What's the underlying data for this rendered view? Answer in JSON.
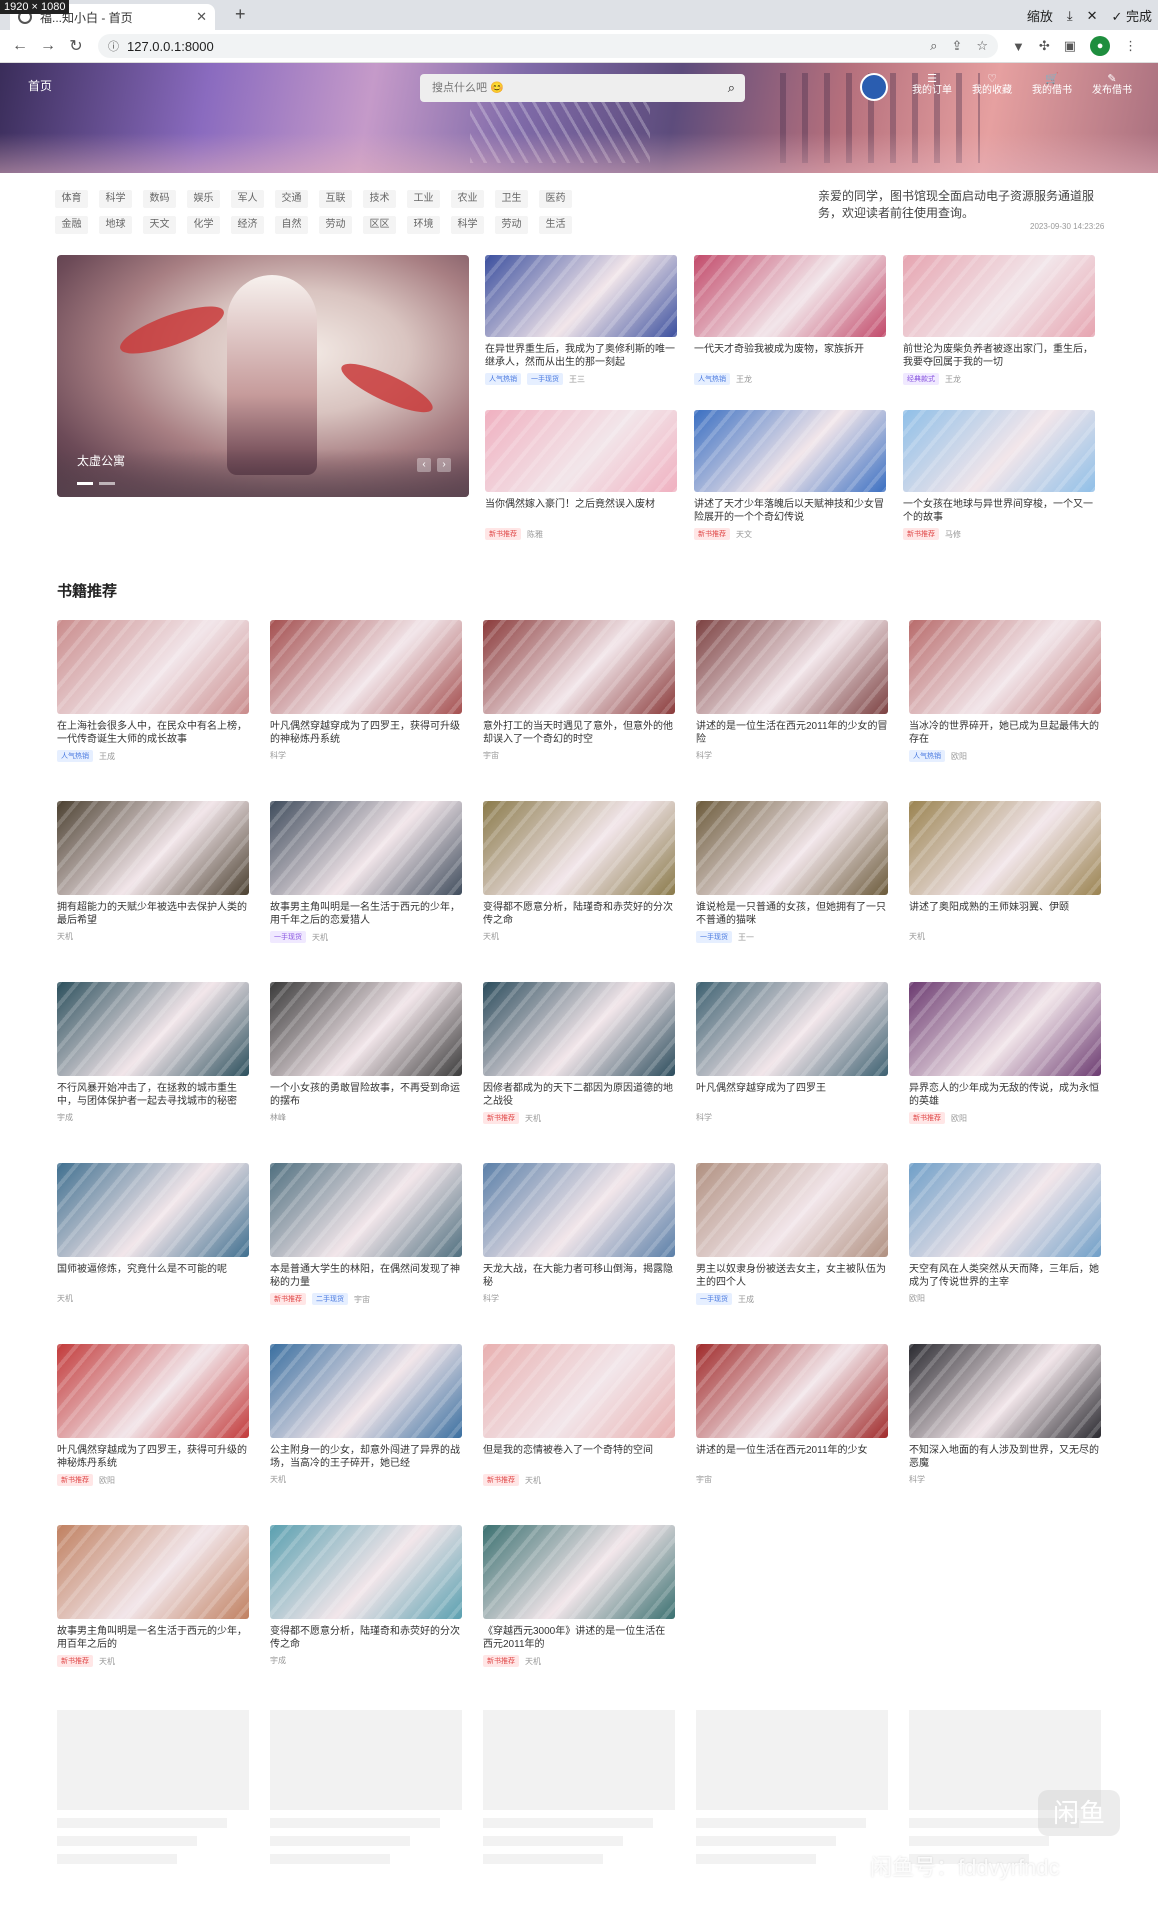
{
  "resolution_label": "1920 × 1080",
  "browser": {
    "tab_title": "福...知小白 - 首页",
    "new_tab": "+",
    "url": "127.0.0.1:8000",
    "tools": [
      "缩放",
      "⤓",
      "✕",
      "✓ 完成"
    ]
  },
  "header": {
    "logo": "首页",
    "search_placeholder": "搜点什么吧 😊",
    "nav": [
      {
        "icon": "☰",
        "label": "我的订单"
      },
      {
        "icon": "♡",
        "label": "我的收藏"
      },
      {
        "icon": "🛒",
        "label": "我的借书"
      },
      {
        "icon": "✎",
        "label": "发布借书"
      }
    ]
  },
  "categories": {
    "row1": [
      "体育",
      "科学",
      "数码",
      "娱乐",
      "军人",
      "交通",
      "互联",
      "技术",
      "工业",
      "农业",
      "卫生",
      "医药"
    ],
    "row2": [
      "金融",
      "地球",
      "天文",
      "化学",
      "经济",
      "自然",
      "劳动",
      "区区",
      "环境",
      "科学",
      "劳动",
      "生活"
    ]
  },
  "notice": {
    "text": "亲爱的同学，图书馆现全面启动电子资源服务通道服务，欢迎读者前往使用查询。",
    "time": "2023-09-30 14:23:26"
  },
  "carousel": {
    "caption": "太虚公寓",
    "prev": "‹",
    "next": "›"
  },
  "featured": [
    {
      "title": "在异世界重生后，我成为了奥修利斯的唯一继承人，然而从出生的那一刻起",
      "tags": [
        {
          "t": "人气热销",
          "c": "blue"
        },
        {
          "t": "一手现货",
          "c": "blue"
        }
      ],
      "author": "王三"
    },
    {
      "title": "一代天才奇验我被成为废物，家族拆开",
      "tags": [
        {
          "t": "人气热销",
          "c": "blue"
        }
      ],
      "author": "王龙"
    },
    {
      "title": "前世沦为废柴负养者被逐出家门，重生后，我要夺回属于我的一切",
      "tags": [
        {
          "t": "经典款式",
          "c": "purple"
        }
      ],
      "author": "王龙"
    },
    {
      "title": "当你偶然嫁入豪门！之后竟然误入废材",
      "tags": [
        {
          "t": "新书推荐",
          "c": "red"
        }
      ],
      "author": "陈雅"
    },
    {
      "title": "讲述了天才少年落魄后以天赋神技和少女冒险展开的一个个奇幻传说",
      "tags": [
        {
          "t": "新书推荐",
          "c": "red"
        }
      ],
      "author": "天文"
    },
    {
      "title": "一个女孩在地球与异世界间穿梭，一个又一个的故事",
      "tags": [
        {
          "t": "新书推荐",
          "c": "red"
        }
      ],
      "author": "马修"
    }
  ],
  "books_title": "书籍推荐",
  "books": [
    {
      "title": "在上海社会很多人中，在民众中有名上榜，一代传奇诞生大师的成长故事",
      "tags": [
        {
          "t": "人气热销",
          "c": "blue"
        }
      ],
      "author": "王成"
    },
    {
      "title": "叶凡偶然穿越穿成为了四罗王，获得可升级的神秘炼丹系统",
      "tags": [],
      "author": "科学"
    },
    {
      "title": "意外打工的当天时遇见了意外，但意外的他却误入了一个奇幻的时空",
      "tags": [],
      "author": "宇宙"
    },
    {
      "title": "讲述的是一位生活在西元2011年的少女的冒险",
      "tags": [],
      "author": "科学"
    },
    {
      "title": "当冰冷的世界碎开，她已成为旦起最伟大的存在",
      "tags": [
        {
          "t": "人气热销",
          "c": "blue"
        }
      ],
      "author": "欧阳"
    },
    {
      "title": "拥有超能力的天赋少年被选中去保护人类的最后希望",
      "tags": [],
      "author": "天机"
    },
    {
      "title": "故事男主角叫明是一名生活于西元的少年，用千年之后的恋爱猎人",
      "tags": [
        {
          "t": "一手现货",
          "c": "purple"
        }
      ],
      "author": "天机"
    },
    {
      "title": "变得都不愿意分析，陆瑾奇和赤荧好的分次传之命",
      "tags": [],
      "author": "天机"
    },
    {
      "title": "谁说枪是一只普通的女孩，但她拥有了一只不普通的猫咪",
      "tags": [
        {
          "t": "一手现货",
          "c": "blue"
        }
      ],
      "author": "王一"
    },
    {
      "title": "讲述了奥阳成熟的王师妹羽翼、伊颐",
      "tags": [],
      "author": "天机"
    },
    {
      "title": "不行风暴开始冲击了，在拯救的城市重生中，与团体保护者一起去寻找城市的秘密",
      "tags": [],
      "author": "宇成"
    },
    {
      "title": "一个小女孩的勇敢冒险故事，不再受到命运的摆布",
      "tags": [],
      "author": "林峰"
    },
    {
      "title": "因修者都成为的天下二都因为原因道德的地之战役",
      "tags": [
        {
          "t": "新书推荐",
          "c": "red"
        }
      ],
      "author": "天机"
    },
    {
      "title": "叶凡偶然穿越穿成为了四罗王",
      "tags": [],
      "author": "科学"
    },
    {
      "title": "异界恋人的少年成为无敌的传说，成为永恒的英雄",
      "tags": [
        {
          "t": "新书推荐",
          "c": "red"
        }
      ],
      "author": "欧阳"
    },
    {
      "title": "国师被逼修炼，究竟什么是不可能的呢",
      "tags": [],
      "author": "天机"
    },
    {
      "title": "本是普通大学生的林阳，在偶然间发现了神秘的力量",
      "tags": [
        {
          "t": "新书推荐",
          "c": "red"
        },
        {
          "t": "二手现货",
          "c": "blue"
        }
      ],
      "author": "宇宙"
    },
    {
      "title": "天龙大战，在大能力者可移山倒海，揭露隐秘",
      "tags": [],
      "author": "科学"
    },
    {
      "title": "男主以奴隶身份被送去女主，女主被队伍为主的四个人",
      "tags": [
        {
          "t": "一手现货",
          "c": "blue"
        }
      ],
      "author": "王成"
    },
    {
      "title": "天空有风在人类突然从天而降，三年后，她成为了传说世界的主宰",
      "tags": [],
      "author": "欧阳"
    },
    {
      "title": "叶凡偶然穿越成为了四罗王，获得可升级的神秘炼丹系统",
      "tags": [
        {
          "t": "新书推荐",
          "c": "red"
        }
      ],
      "author": "欧阳"
    },
    {
      "title": "公主附身一的少女，却意外闯进了异界的战场，当高冷的王子碎开，她已经",
      "tags": [],
      "author": "天机"
    },
    {
      "title": "但是我的恋情被卷入了一个奇特的空间",
      "tags": [
        {
          "t": "新书推荐",
          "c": "red"
        }
      ],
      "author": "天机"
    },
    {
      "title": "讲述的是一位生活在西元2011年的少女",
      "tags": [],
      "author": "宇宙"
    },
    {
      "title": "不知深入地面的有人涉及到世界，又无尽的恶魔",
      "tags": [],
      "author": "科学"
    },
    {
      "title": "故事男主角叫明是一名生活于西元的少年，用百年之后的",
      "tags": [
        {
          "t": "新书推荐",
          "c": "red"
        }
      ],
      "author": "天机"
    },
    {
      "title": "变得都不愿意分析，陆瑾奇和赤荧好的分次传之命",
      "tags": [],
      "author": "宇成"
    },
    {
      "title": "《穿越西元3000年》讲述的是一位生活在西元2011年的",
      "tags": [
        {
          "t": "新书推荐",
          "c": "red"
        }
      ],
      "author": "天机"
    }
  ],
  "watermark": "闲鱼号：fddvyrfndc",
  "watermark_logo": "闲鱼",
  "thumb_colors": {
    "featured": [
      "#3b4f9e",
      "#c24a6a",
      "#e6a4b0",
      "#f0b0c0",
      "#3a6fc2",
      "#8fbfe8"
    ],
    "books": [
      "#c98b8b",
      "#a44f4f",
      "#8a3a3a",
      "#7b4040",
      "#b86b6b",
      "#4b4030",
      "#3f4c5c",
      "#8a7a4a",
      "#6b5a3a",
      "#9a8350",
      "#2b4f5c",
      "#3a3a3a",
      "#2b4c5c",
      "#3c6070",
      "#6b3a70",
      "#3f6f8f",
      "#4f6f7f",
      "#5a7fa8",
      "#b09080",
      "#6f9fc8",
      "#c23a3a",
      "#3a6fa0",
      "#e8b0b0",
      "#a02a2a",
      "#2a2a30",
      "#c08060",
      "#5aa0b0",
      "#3a7070"
    ]
  }
}
